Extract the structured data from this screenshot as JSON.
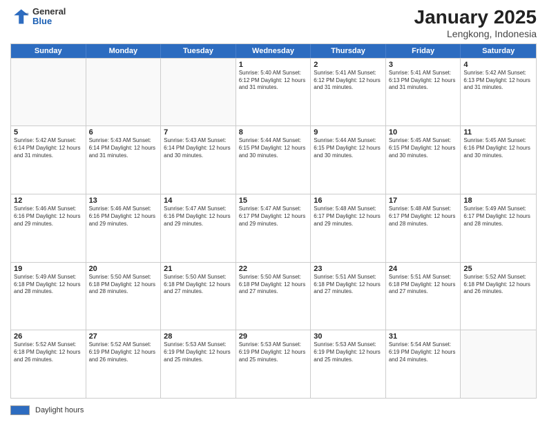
{
  "header": {
    "logo_general": "General",
    "logo_blue": "Blue",
    "title": "January 2025",
    "subtitle": "Lengkong, Indonesia"
  },
  "calendar": {
    "days_of_week": [
      "Sunday",
      "Monday",
      "Tuesday",
      "Wednesday",
      "Thursday",
      "Friday",
      "Saturday"
    ],
    "weeks": [
      [
        {
          "day": "",
          "info": ""
        },
        {
          "day": "",
          "info": ""
        },
        {
          "day": "",
          "info": ""
        },
        {
          "day": "1",
          "info": "Sunrise: 5:40 AM\nSunset: 6:12 PM\nDaylight: 12 hours\nand 31 minutes."
        },
        {
          "day": "2",
          "info": "Sunrise: 5:41 AM\nSunset: 6:12 PM\nDaylight: 12 hours\nand 31 minutes."
        },
        {
          "day": "3",
          "info": "Sunrise: 5:41 AM\nSunset: 6:13 PM\nDaylight: 12 hours\nand 31 minutes."
        },
        {
          "day": "4",
          "info": "Sunrise: 5:42 AM\nSunset: 6:13 PM\nDaylight: 12 hours\nand 31 minutes."
        }
      ],
      [
        {
          "day": "5",
          "info": "Sunrise: 5:42 AM\nSunset: 6:14 PM\nDaylight: 12 hours\nand 31 minutes."
        },
        {
          "day": "6",
          "info": "Sunrise: 5:43 AM\nSunset: 6:14 PM\nDaylight: 12 hours\nand 31 minutes."
        },
        {
          "day": "7",
          "info": "Sunrise: 5:43 AM\nSunset: 6:14 PM\nDaylight: 12 hours\nand 30 minutes."
        },
        {
          "day": "8",
          "info": "Sunrise: 5:44 AM\nSunset: 6:15 PM\nDaylight: 12 hours\nand 30 minutes."
        },
        {
          "day": "9",
          "info": "Sunrise: 5:44 AM\nSunset: 6:15 PM\nDaylight: 12 hours\nand 30 minutes."
        },
        {
          "day": "10",
          "info": "Sunrise: 5:45 AM\nSunset: 6:15 PM\nDaylight: 12 hours\nand 30 minutes."
        },
        {
          "day": "11",
          "info": "Sunrise: 5:45 AM\nSunset: 6:16 PM\nDaylight: 12 hours\nand 30 minutes."
        }
      ],
      [
        {
          "day": "12",
          "info": "Sunrise: 5:46 AM\nSunset: 6:16 PM\nDaylight: 12 hours\nand 29 minutes."
        },
        {
          "day": "13",
          "info": "Sunrise: 5:46 AM\nSunset: 6:16 PM\nDaylight: 12 hours\nand 29 minutes."
        },
        {
          "day": "14",
          "info": "Sunrise: 5:47 AM\nSunset: 6:16 PM\nDaylight: 12 hours\nand 29 minutes."
        },
        {
          "day": "15",
          "info": "Sunrise: 5:47 AM\nSunset: 6:17 PM\nDaylight: 12 hours\nand 29 minutes."
        },
        {
          "day": "16",
          "info": "Sunrise: 5:48 AM\nSunset: 6:17 PM\nDaylight: 12 hours\nand 29 minutes."
        },
        {
          "day": "17",
          "info": "Sunrise: 5:48 AM\nSunset: 6:17 PM\nDaylight: 12 hours\nand 28 minutes."
        },
        {
          "day": "18",
          "info": "Sunrise: 5:49 AM\nSunset: 6:17 PM\nDaylight: 12 hours\nand 28 minutes."
        }
      ],
      [
        {
          "day": "19",
          "info": "Sunrise: 5:49 AM\nSunset: 6:18 PM\nDaylight: 12 hours\nand 28 minutes."
        },
        {
          "day": "20",
          "info": "Sunrise: 5:50 AM\nSunset: 6:18 PM\nDaylight: 12 hours\nand 28 minutes."
        },
        {
          "day": "21",
          "info": "Sunrise: 5:50 AM\nSunset: 6:18 PM\nDaylight: 12 hours\nand 27 minutes."
        },
        {
          "day": "22",
          "info": "Sunrise: 5:50 AM\nSunset: 6:18 PM\nDaylight: 12 hours\nand 27 minutes."
        },
        {
          "day": "23",
          "info": "Sunrise: 5:51 AM\nSunset: 6:18 PM\nDaylight: 12 hours\nand 27 minutes."
        },
        {
          "day": "24",
          "info": "Sunrise: 5:51 AM\nSunset: 6:18 PM\nDaylight: 12 hours\nand 27 minutes."
        },
        {
          "day": "25",
          "info": "Sunrise: 5:52 AM\nSunset: 6:18 PM\nDaylight: 12 hours\nand 26 minutes."
        }
      ],
      [
        {
          "day": "26",
          "info": "Sunrise: 5:52 AM\nSunset: 6:18 PM\nDaylight: 12 hours\nand 26 minutes."
        },
        {
          "day": "27",
          "info": "Sunrise: 5:52 AM\nSunset: 6:19 PM\nDaylight: 12 hours\nand 26 minutes."
        },
        {
          "day": "28",
          "info": "Sunrise: 5:53 AM\nSunset: 6:19 PM\nDaylight: 12 hours\nand 25 minutes."
        },
        {
          "day": "29",
          "info": "Sunrise: 5:53 AM\nSunset: 6:19 PM\nDaylight: 12 hours\nand 25 minutes."
        },
        {
          "day": "30",
          "info": "Sunrise: 5:53 AM\nSunset: 6:19 PM\nDaylight: 12 hours\nand 25 minutes."
        },
        {
          "day": "31",
          "info": "Sunrise: 5:54 AM\nSunset: 6:19 PM\nDaylight: 12 hours\nand 24 minutes."
        },
        {
          "day": "",
          "info": ""
        }
      ]
    ]
  },
  "footer": {
    "label": "Daylight hours"
  }
}
